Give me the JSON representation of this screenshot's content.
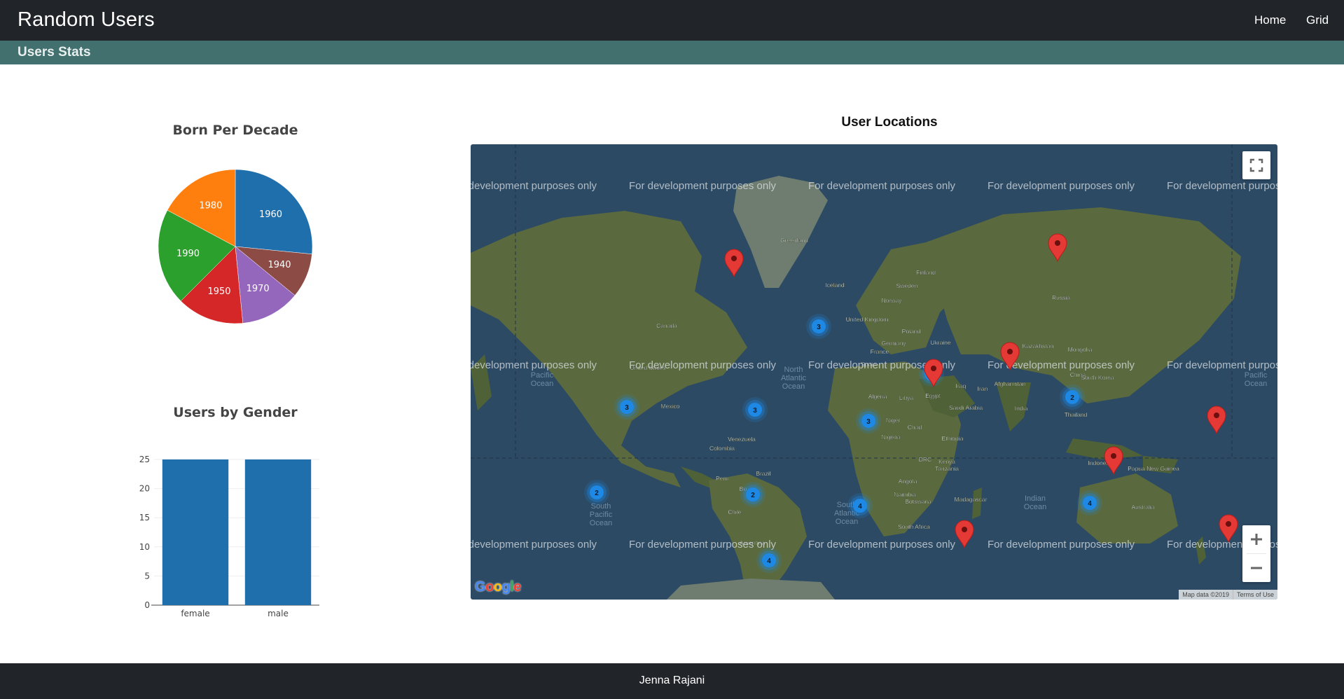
{
  "navbar": {
    "brand": "Random Users",
    "links": [
      "Home",
      "Grid"
    ]
  },
  "subheader": {
    "title": "Users Stats"
  },
  "pie_chart": {
    "title": "Born Per Decade"
  },
  "bar_chart": {
    "title": "Users by Gender"
  },
  "map": {
    "title": "User Locations",
    "watermark": "For development purposes only",
    "logo": "Google",
    "attribution": "Map data ©2019",
    "terms": "Terms of Use",
    "fullscreen_icon": "fullscreen-icon",
    "zoom_in_icon": "plus-icon",
    "zoom_out_icon": "minus-icon",
    "labels": [
      {
        "name": "Greenland"
      },
      {
        "name": "Iceland"
      },
      {
        "name": "Finland"
      },
      {
        "name": "Sweden"
      },
      {
        "name": "Norway"
      },
      {
        "name": "Russia"
      },
      {
        "name": "United Kingdom"
      },
      {
        "name": "Poland"
      },
      {
        "name": "Germany"
      },
      {
        "name": "Ukraine"
      },
      {
        "name": "France"
      },
      {
        "name": "Spain"
      },
      {
        "name": "Kazakhstan"
      },
      {
        "name": "Mongolia"
      },
      {
        "name": "Canada"
      },
      {
        "name": "United States"
      },
      {
        "name": "Mexico"
      },
      {
        "name": "Afghanistan"
      },
      {
        "name": "Iraq"
      },
      {
        "name": "Iran"
      },
      {
        "name": "China"
      },
      {
        "name": "South Korea"
      },
      {
        "name": "Algeria"
      },
      {
        "name": "Libya"
      },
      {
        "name": "Egypt"
      },
      {
        "name": "Saudi Arabia"
      },
      {
        "name": "India"
      },
      {
        "name": "Thailand"
      },
      {
        "name": "Niger"
      },
      {
        "name": "Chad"
      },
      {
        "name": "Nigeria"
      },
      {
        "name": "Ethiopia"
      },
      {
        "name": "Venezuela"
      },
      {
        "name": "Colombia"
      },
      {
        "name": "Brazil"
      },
      {
        "name": "Peru"
      },
      {
        "name": "Kenya"
      },
      {
        "name": "DRC"
      },
      {
        "name": "Tanzania"
      },
      {
        "name": "Indonesia"
      },
      {
        "name": "Papua New Guinea"
      },
      {
        "name": "Angola"
      },
      {
        "name": "Namibia"
      },
      {
        "name": "Botswana"
      },
      {
        "name": "Madagascar"
      },
      {
        "name": "South Africa"
      },
      {
        "name": "Australia"
      },
      {
        "name": "Chile"
      },
      {
        "name": "Argentina"
      },
      {
        "name": "Bo"
      }
    ],
    "oceans": [
      {
        "lines": [
          "Pacific",
          "Ocean"
        ]
      },
      {
        "lines": [
          "North",
          "Atlantic",
          "Ocean"
        ]
      },
      {
        "lines": [
          "South",
          "Pacific",
          "Ocean"
        ]
      },
      {
        "lines": [
          "South",
          "Atlantic",
          "Ocean"
        ]
      },
      {
        "lines": [
          "Indian",
          "Ocean"
        ]
      },
      {
        "lines": [
          "Pacific",
          "Ocean"
        ]
      }
    ],
    "clusters": [
      "3",
      "2",
      "2",
      "3",
      "3",
      "3",
      "2",
      "2",
      "4",
      "4",
      "4"
    ],
    "markers": 8,
    "marker_color": "#e53935",
    "cluster_color": "#1e88e5"
  },
  "footer": {
    "text": "Jenna Rajani"
  },
  "chart_data": [
    {
      "type": "pie",
      "title": "Born Per Decade",
      "labels": [
        "1960",
        "1940",
        "1970",
        "1950",
        "1990",
        "1980"
      ],
      "values": [
        17,
        6,
        8,
        9,
        13,
        11
      ],
      "colors": [
        "#1f6fad",
        "#8c4b45",
        "#9467bd",
        "#d62728",
        "#2ca02c",
        "#ff7f0e"
      ]
    },
    {
      "type": "bar",
      "title": "Users by Gender",
      "categories": [
        "female",
        "male"
      ],
      "values": [
        25,
        25
      ],
      "ylim": [
        0,
        25
      ],
      "yticks": [
        0,
        5,
        10,
        15,
        20,
        25
      ],
      "color": "#1f6fad"
    }
  ]
}
